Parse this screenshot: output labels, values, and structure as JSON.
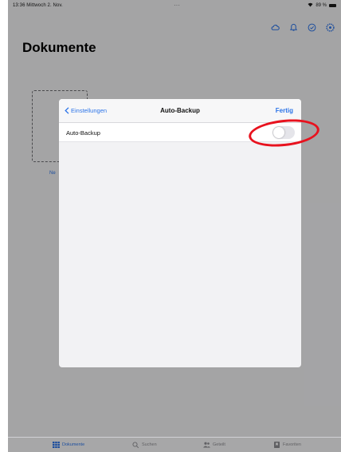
{
  "status_bar": {
    "datetime": "13:36  Mittwoch 2. Nov.",
    "battery": "89 %"
  },
  "header": {
    "title": "Dokumente",
    "icons": [
      "cloud-icon",
      "bell-icon",
      "checkmark-circle-icon",
      "settings-icon"
    ]
  },
  "background": {
    "doc_caption": "Ne"
  },
  "modal": {
    "back_label": "Einstellungen",
    "title": "Auto-Backup",
    "done_label": "Fertig",
    "row_label": "Auto-Backup",
    "toggle_on": false
  },
  "tab_bar": {
    "tabs": [
      {
        "label": "Dokumente",
        "icon": "grid-icon",
        "active": true
      },
      {
        "label": "Suchen",
        "icon": "search-icon",
        "active": false
      },
      {
        "label": "Geteilt",
        "icon": "people-icon",
        "active": false
      },
      {
        "label": "Favoriten",
        "icon": "bookmark-icon",
        "active": false
      }
    ]
  },
  "colors": {
    "accent": "#2c74e8",
    "annotation": "#e8121e"
  }
}
